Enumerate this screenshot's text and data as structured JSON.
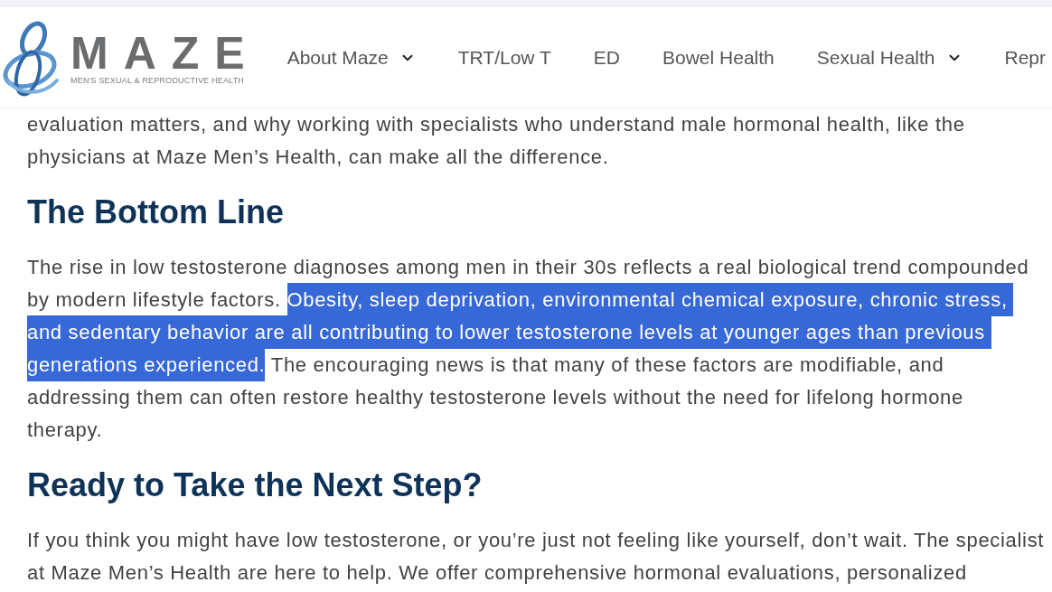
{
  "header": {
    "logo": {
      "wordmark": "MAZE",
      "tagline": "MEN'S SEXUAL & REPRODUCTIVE HEALTH"
    },
    "nav": [
      {
        "label": "About Maze",
        "kind": "dropdown"
      },
      {
        "label": "TRT/Low T",
        "kind": "link"
      },
      {
        "label": "ED",
        "kind": "link"
      },
      {
        "label": "Bowel Health",
        "kind": "link"
      },
      {
        "label": "Sexual Health",
        "kind": "dropdown"
      },
      {
        "label": "Repr",
        "kind": "link"
      }
    ]
  },
  "article": {
    "blocks": [
      {
        "kind": "paragraph",
        "segments": [
          {
            "text": "evaluation matters, and why working with specialists who understand male hormonal health, like the\nphysicians at Maze Men’s Health, can make all the difference.",
            "selected": false
          }
        ]
      },
      {
        "kind": "heading",
        "text": "The Bottom Line"
      },
      {
        "kind": "paragraph",
        "segments": [
          {
            "text": "The rise in low testosterone diagnoses among men in their 30s reflects a real biological trend compounded\nby modern lifestyle factors. ",
            "selected": false
          },
          {
            "text": "Obesity, sleep deprivation, environmental chemical exposure, chronic stress, \nand sedentary behavior are all contributing to lower testosterone levels at younger ages than previous \ngenerations experienced.",
            "selected": true
          },
          {
            "text": " The encouraging news is that many of these factors are modifiable, and\naddressing them can often restore healthy testosterone levels without the need for lifelong hormone\ntherapy.",
            "selected": false
          }
        ]
      },
      {
        "kind": "heading",
        "text": "Ready to Take the Next Step?"
      },
      {
        "kind": "paragraph",
        "segments": [
          {
            "text": "If you think you might have low testosterone, or you’re just not feeling like yourself, don’t wait. The specialist\nat Maze Men’s Health are here to help. We offer comprehensive hormonal evaluations, personalized",
            "selected": false
          }
        ]
      }
    ]
  }
}
